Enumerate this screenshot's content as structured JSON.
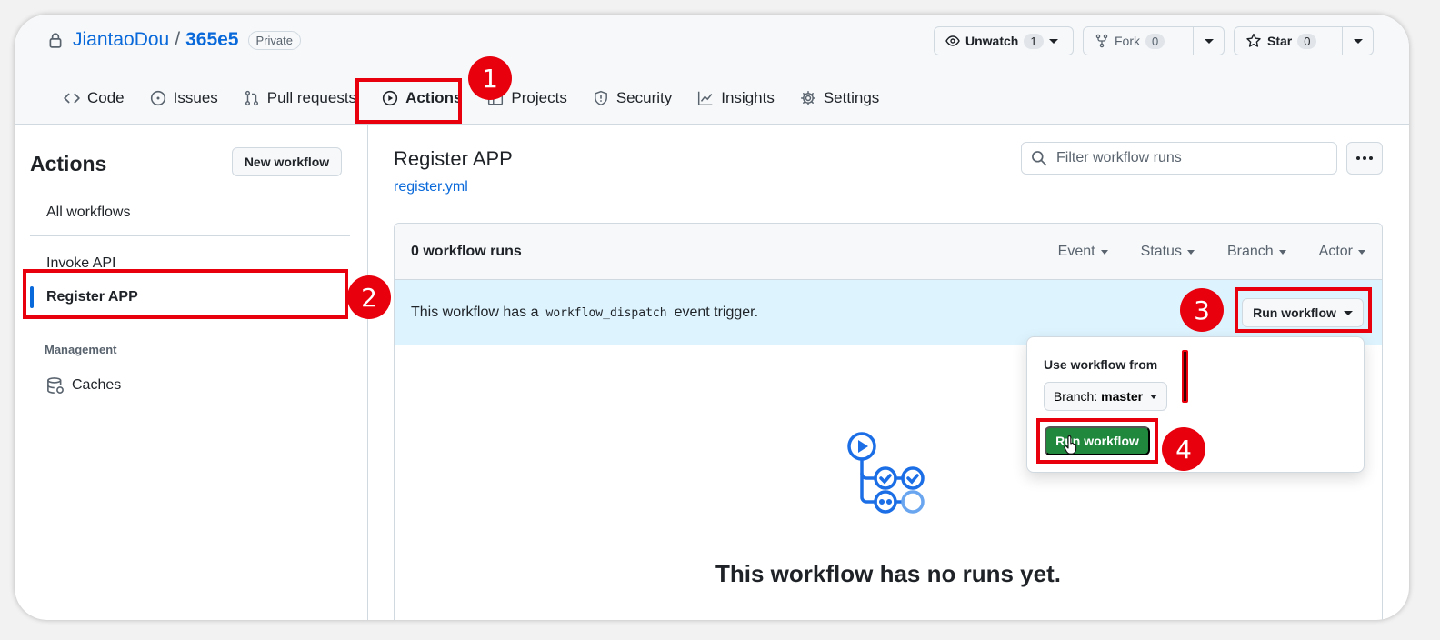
{
  "repo": {
    "owner": "JiantaoDou",
    "separator": "/",
    "name": "365e5",
    "visibility": "Private"
  },
  "repo_actions": {
    "unwatch": {
      "label": "Unwatch",
      "count": "1"
    },
    "fork": {
      "label": "Fork",
      "count": "0"
    },
    "star": {
      "label": "Star",
      "count": "0"
    }
  },
  "tabs": [
    {
      "label": "Code",
      "icon": "code-icon"
    },
    {
      "label": "Issues",
      "icon": "issue-opened-icon"
    },
    {
      "label": "Pull requests",
      "icon": "git-pull-request-icon"
    },
    {
      "label": "Actions",
      "icon": "play-icon",
      "active": true
    },
    {
      "label": "Projects",
      "icon": "table-icon"
    },
    {
      "label": "Security",
      "icon": "shield-icon"
    },
    {
      "label": "Insights",
      "icon": "graph-icon"
    },
    {
      "label": "Settings",
      "icon": "gear-icon"
    }
  ],
  "sidebar": {
    "title": "Actions",
    "new_workflow": "New workflow",
    "all_workflows": "All workflows",
    "workflows": [
      "Invoke API",
      "Register APP"
    ],
    "management_label": "Management",
    "caches": "Caches"
  },
  "main": {
    "title": "Register APP",
    "file_link": "register.yml",
    "filter_placeholder": "Filter workflow runs",
    "runs_count": "0 workflow runs",
    "filters": [
      "Event",
      "Status",
      "Branch",
      "Actor"
    ],
    "dispatch": {
      "prefix": "This workflow has a",
      "code": "workflow_dispatch",
      "suffix": "event trigger."
    },
    "run_workflow": "Run workflow",
    "empty_text": "This workflow has no runs yet."
  },
  "dropdown": {
    "label": "Use workflow from",
    "branch_prefix": "Branch:",
    "branch_name": "master",
    "run_button": "Run workflow"
  },
  "annotations": [
    "1",
    "2",
    "3",
    "4"
  ],
  "colors": {
    "accent": "#0969da",
    "highlight": "#e8000d",
    "run_button": "#1f883d",
    "dispatch_bg": "#ddf4ff"
  }
}
